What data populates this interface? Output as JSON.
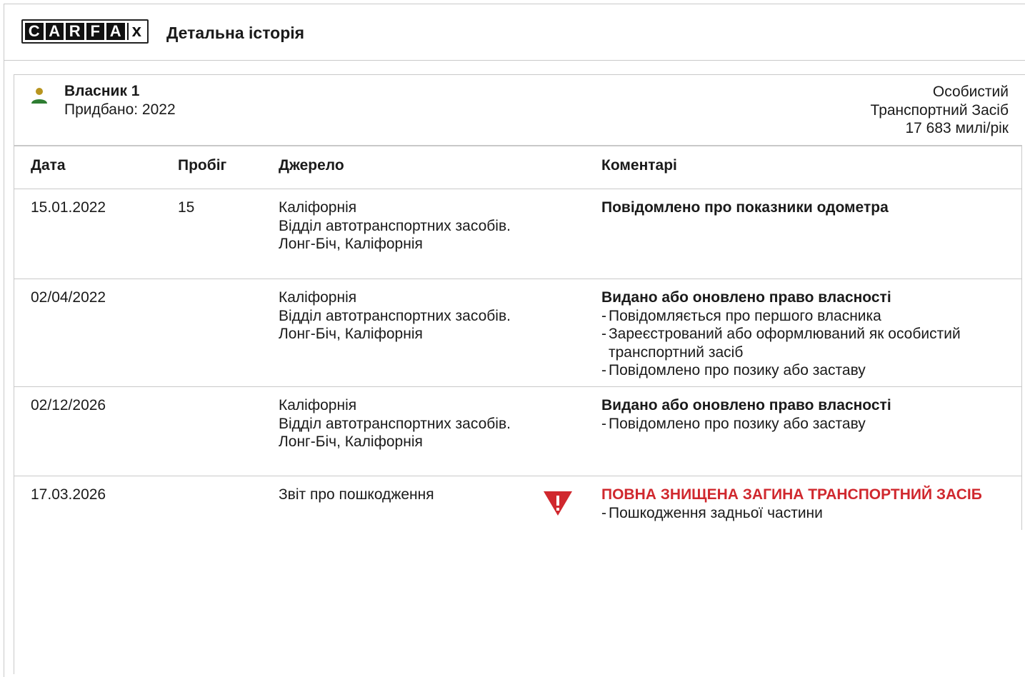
{
  "header": {
    "logo_letters": [
      "C",
      "A",
      "R",
      "F",
      "A",
      "x"
    ],
    "logo_label": "CARFAX",
    "title": "Детальна історія"
  },
  "owner": {
    "name": "Власник 1",
    "purchased": "Придбано: 2022",
    "type_line1": "Особистий",
    "type_line2": "Транспортний Засіб",
    "mileage_rate": "17 683 милі/рік",
    "icon": "person-icon",
    "icon_colors": {
      "head": "#b8951f",
      "body": "#2e7d32"
    }
  },
  "table": {
    "columns": [
      "Дата",
      "Пробіг",
      "Джерело",
      "Коментарі"
    ],
    "rows": [
      {
        "date": "15.01.2022",
        "mileage": "15",
        "source": [
          "Каліфорнія",
          "Відділ автотранспортних засобів.",
          "Лонг-Біч, Каліфорнія"
        ],
        "comment_title": "Повідомлено про показники одометра",
        "comment_items": []
      },
      {
        "date": "02/04/2022",
        "mileage": "",
        "source": [
          "Каліфорнія",
          "Відділ автотранспортних засобів.",
          "Лонг-Біч, Каліфорнія"
        ],
        "comment_title": "Видано або оновлено право власності",
        "comment_items": [
          "Повідомляється про першого власника",
          "Зареєстрований або оформлюваний як особистий транспортний засіб",
          "Повідомлено про позику або заставу"
        ]
      },
      {
        "date": "02/12/2026",
        "mileage": "",
        "source": [
          "Каліфорнія",
          "Відділ автотранспортних засобів.",
          "Лонг-Біч, Каліфорнія"
        ],
        "comment_title": "Видано або оновлено право власності",
        "comment_items": [
          "Повідомлено про позику або заставу"
        ]
      },
      {
        "date": "17.03.2026",
        "mileage": "",
        "source": [
          "Звіт про пошкодження"
        ],
        "warning_icon": "alert-triangle-icon",
        "comment_title": "ПОВНА ЗНИЩЕНА ЗАГИНА ТРАНСПОРТНИЙ ЗАСІБ",
        "comment_items": [
          "Пошкодження задньої частини"
        ]
      }
    ]
  },
  "colors": {
    "alert": "#d0282e",
    "border": "#c9c9c9",
    "text": "#1a1a1a"
  }
}
